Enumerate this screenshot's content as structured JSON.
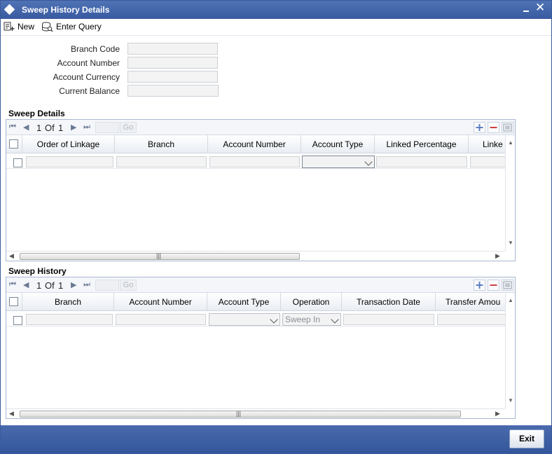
{
  "window": {
    "title": "Sweep History Details",
    "close_glyph": "✕"
  },
  "toolbar": {
    "new_label": "New",
    "enter_query_label": "Enter Query"
  },
  "form": {
    "fields": [
      {
        "label": "Branch Code",
        "value": ""
      },
      {
        "label": "Account Number",
        "value": ""
      },
      {
        "label": "Account Currency",
        "value": ""
      },
      {
        "label": "Current Balance",
        "value": ""
      }
    ]
  },
  "sweep_details": {
    "title": "Sweep Details",
    "pager": {
      "current": "1",
      "of_label": "Of",
      "total": "1",
      "go_label": "Go"
    },
    "columns": [
      "Order of Linkage",
      "Branch",
      "Account Number",
      "Account Type",
      "Linked Percentage",
      "Linke"
    ]
  },
  "sweep_history": {
    "title": "Sweep History",
    "pager": {
      "current": "1",
      "of_label": "Of",
      "total": "1",
      "go_label": "Go"
    },
    "columns": [
      "Branch",
      "Account Number",
      "Account Type",
      "Operation",
      "Transaction Date",
      "Transfer Amou"
    ],
    "row": {
      "operation_value": "Sweep In"
    }
  },
  "footer": {
    "exit_label": "Exit"
  },
  "icons": {
    "first": "⏮",
    "prev": "◀",
    "next": "▶",
    "last": "⏭",
    "scroll_up": "▲",
    "scroll_down": "▼",
    "scroll_left": "◀",
    "scroll_right": "▶",
    "grip": "|||"
  },
  "colors": {
    "titlebar": "#4466aa",
    "footer": "#3a5a9c",
    "accent_add": "#5b7fc0",
    "accent_delete": "#d04040"
  }
}
